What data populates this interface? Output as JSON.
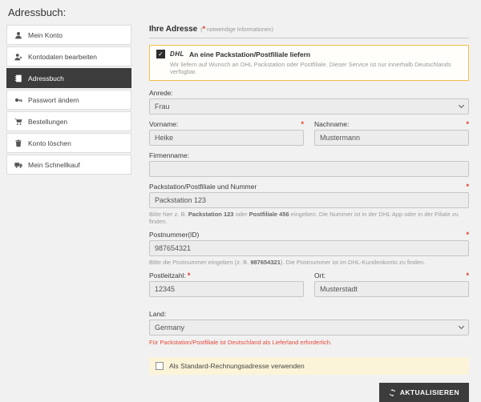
{
  "page": {
    "title": "Adressbuch:"
  },
  "colors": {
    "accent_dark": "#3c3c3c",
    "warning_border": "#f0c04a",
    "highlight_bg": "#fcf4d9",
    "required_red": "#e63323",
    "error_red": "#e5493a"
  },
  "sidebar": {
    "items": [
      {
        "label": "Mein Konto",
        "icon": "user-icon",
        "active": false
      },
      {
        "label": "Kontodaten bearbeiten",
        "icon": "user-edit-icon",
        "active": false
      },
      {
        "label": "Adressbuch",
        "icon": "address-book-icon",
        "active": true
      },
      {
        "label": "Passwort ändern",
        "icon": "key-icon",
        "active": false
      },
      {
        "label": "Bestellungen",
        "icon": "cart-icon",
        "active": false
      },
      {
        "label": "Konto löschen",
        "icon": "trash-icon",
        "active": false
      },
      {
        "label": "Mein Schnellkauf",
        "icon": "truck-icon",
        "active": false
      }
    ]
  },
  "form": {
    "heading": "Ihre Adresse",
    "required_note_open": "(",
    "required_star": "*",
    "required_note_text": " notwendige Informationen)",
    "dhl": {
      "logo": "DHL",
      "title": "An eine Packstation/Postfiliale liefern",
      "subtitle": "Wir liefern auf Wunsch an DHL Packstation oder Postfiliale. Dieser Service ist nur innerhalb Deutschlands verfügbar.",
      "checked": true
    },
    "fields": {
      "anrede": {
        "label": "Anrede:",
        "value": "Frau"
      },
      "vorname": {
        "label": "Vorname:",
        "required": "*",
        "value": "Heike"
      },
      "nachname": {
        "label": "Nachname:",
        "required": "*",
        "value": "Mustermann"
      },
      "firmenname": {
        "label": "Firmenname:",
        "value": ""
      },
      "packstation": {
        "label": "Packstation/Postfiliale und Nummer",
        "required": "*",
        "value": "Packstation 123",
        "help_pre": "Bitte hier z. B. ",
        "help_bold1": "Packstation 123",
        "help_mid": " oder ",
        "help_bold2": "Postfiliale 456",
        "help_post": " eingeben. Die Nummer ist in der DHL App oder in der Filiale zu finden."
      },
      "postnummer": {
        "label": "Postnummer(ID)",
        "required": "*",
        "value": "987654321",
        "help_pre": "Bitte die Postnummer eingeben (z. B. ",
        "help_bold": "987654321",
        "help_post": "). Die Postnummer ist im DHL-Kundenkonto zu finden."
      },
      "postleitzahl": {
        "label": "Postleitzahl:",
        "required": "*",
        "value": "12345"
      },
      "ort": {
        "label": "Ort:",
        "required": "*",
        "value": "Musterstadt"
      },
      "land": {
        "label": "Land:",
        "value": "Germany",
        "note": "Für Packstation/Postfiliale ist Deutschland als Lieferland erforderlich."
      }
    },
    "standard_checkbox_label": "Als Standard-Rechnungsadresse verwenden",
    "standard_checkbox_checked": false,
    "submit_label": "AKTUALISIEREN"
  }
}
